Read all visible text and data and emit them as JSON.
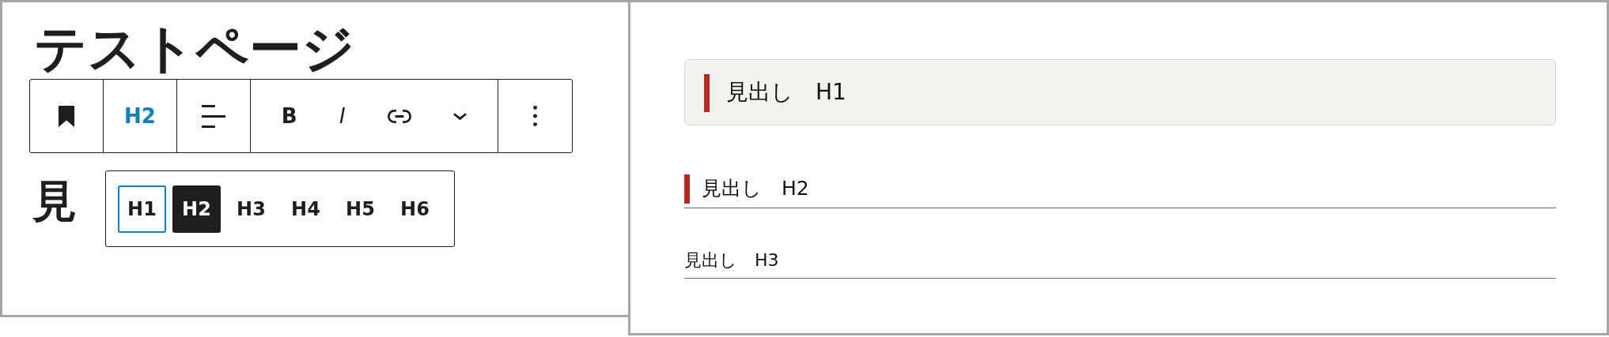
{
  "editor": {
    "title": "テストページ",
    "toolbar": [
      {
        "items": [
          {
            "kind": "icon"
          }
        ]
      },
      {
        "items": [
          {
            "kind": "text",
            "text": "H2",
            "selected": true
          }
        ]
      },
      {
        "items": [
          {
            "kind": "icon"
          }
        ]
      },
      {
        "items": [
          {
            "kind": "text",
            "text": "B",
            "selected": false
          },
          {
            "kind": "italic",
            "text": "I",
            "selected": false
          },
          {
            "kind": "icon"
          },
          {
            "kind": "icon"
          }
        ]
      },
      {
        "items": [
          {
            "kind": "icon"
          }
        ]
      }
    ],
    "heading_levels": [
      {
        "label": "H1",
        "selected": false,
        "focused": true
      },
      {
        "label": "H2",
        "selected": true,
        "focused": false
      },
      {
        "label": "H3",
        "selected": false,
        "focused": false
      },
      {
        "label": "H4",
        "selected": false,
        "focused": false
      },
      {
        "label": "H5",
        "selected": false,
        "focused": false
      },
      {
        "label": "H6",
        "selected": false,
        "focused": false
      }
    ],
    "heading_text": "見"
  },
  "preview": {
    "headings": [
      {
        "kind": "h1",
        "text": "見出し　H1"
      },
      {
        "kind": "h2",
        "text": "見出し　H2"
      },
      {
        "kind": "h3",
        "text": "見出し　H3"
      }
    ]
  }
}
